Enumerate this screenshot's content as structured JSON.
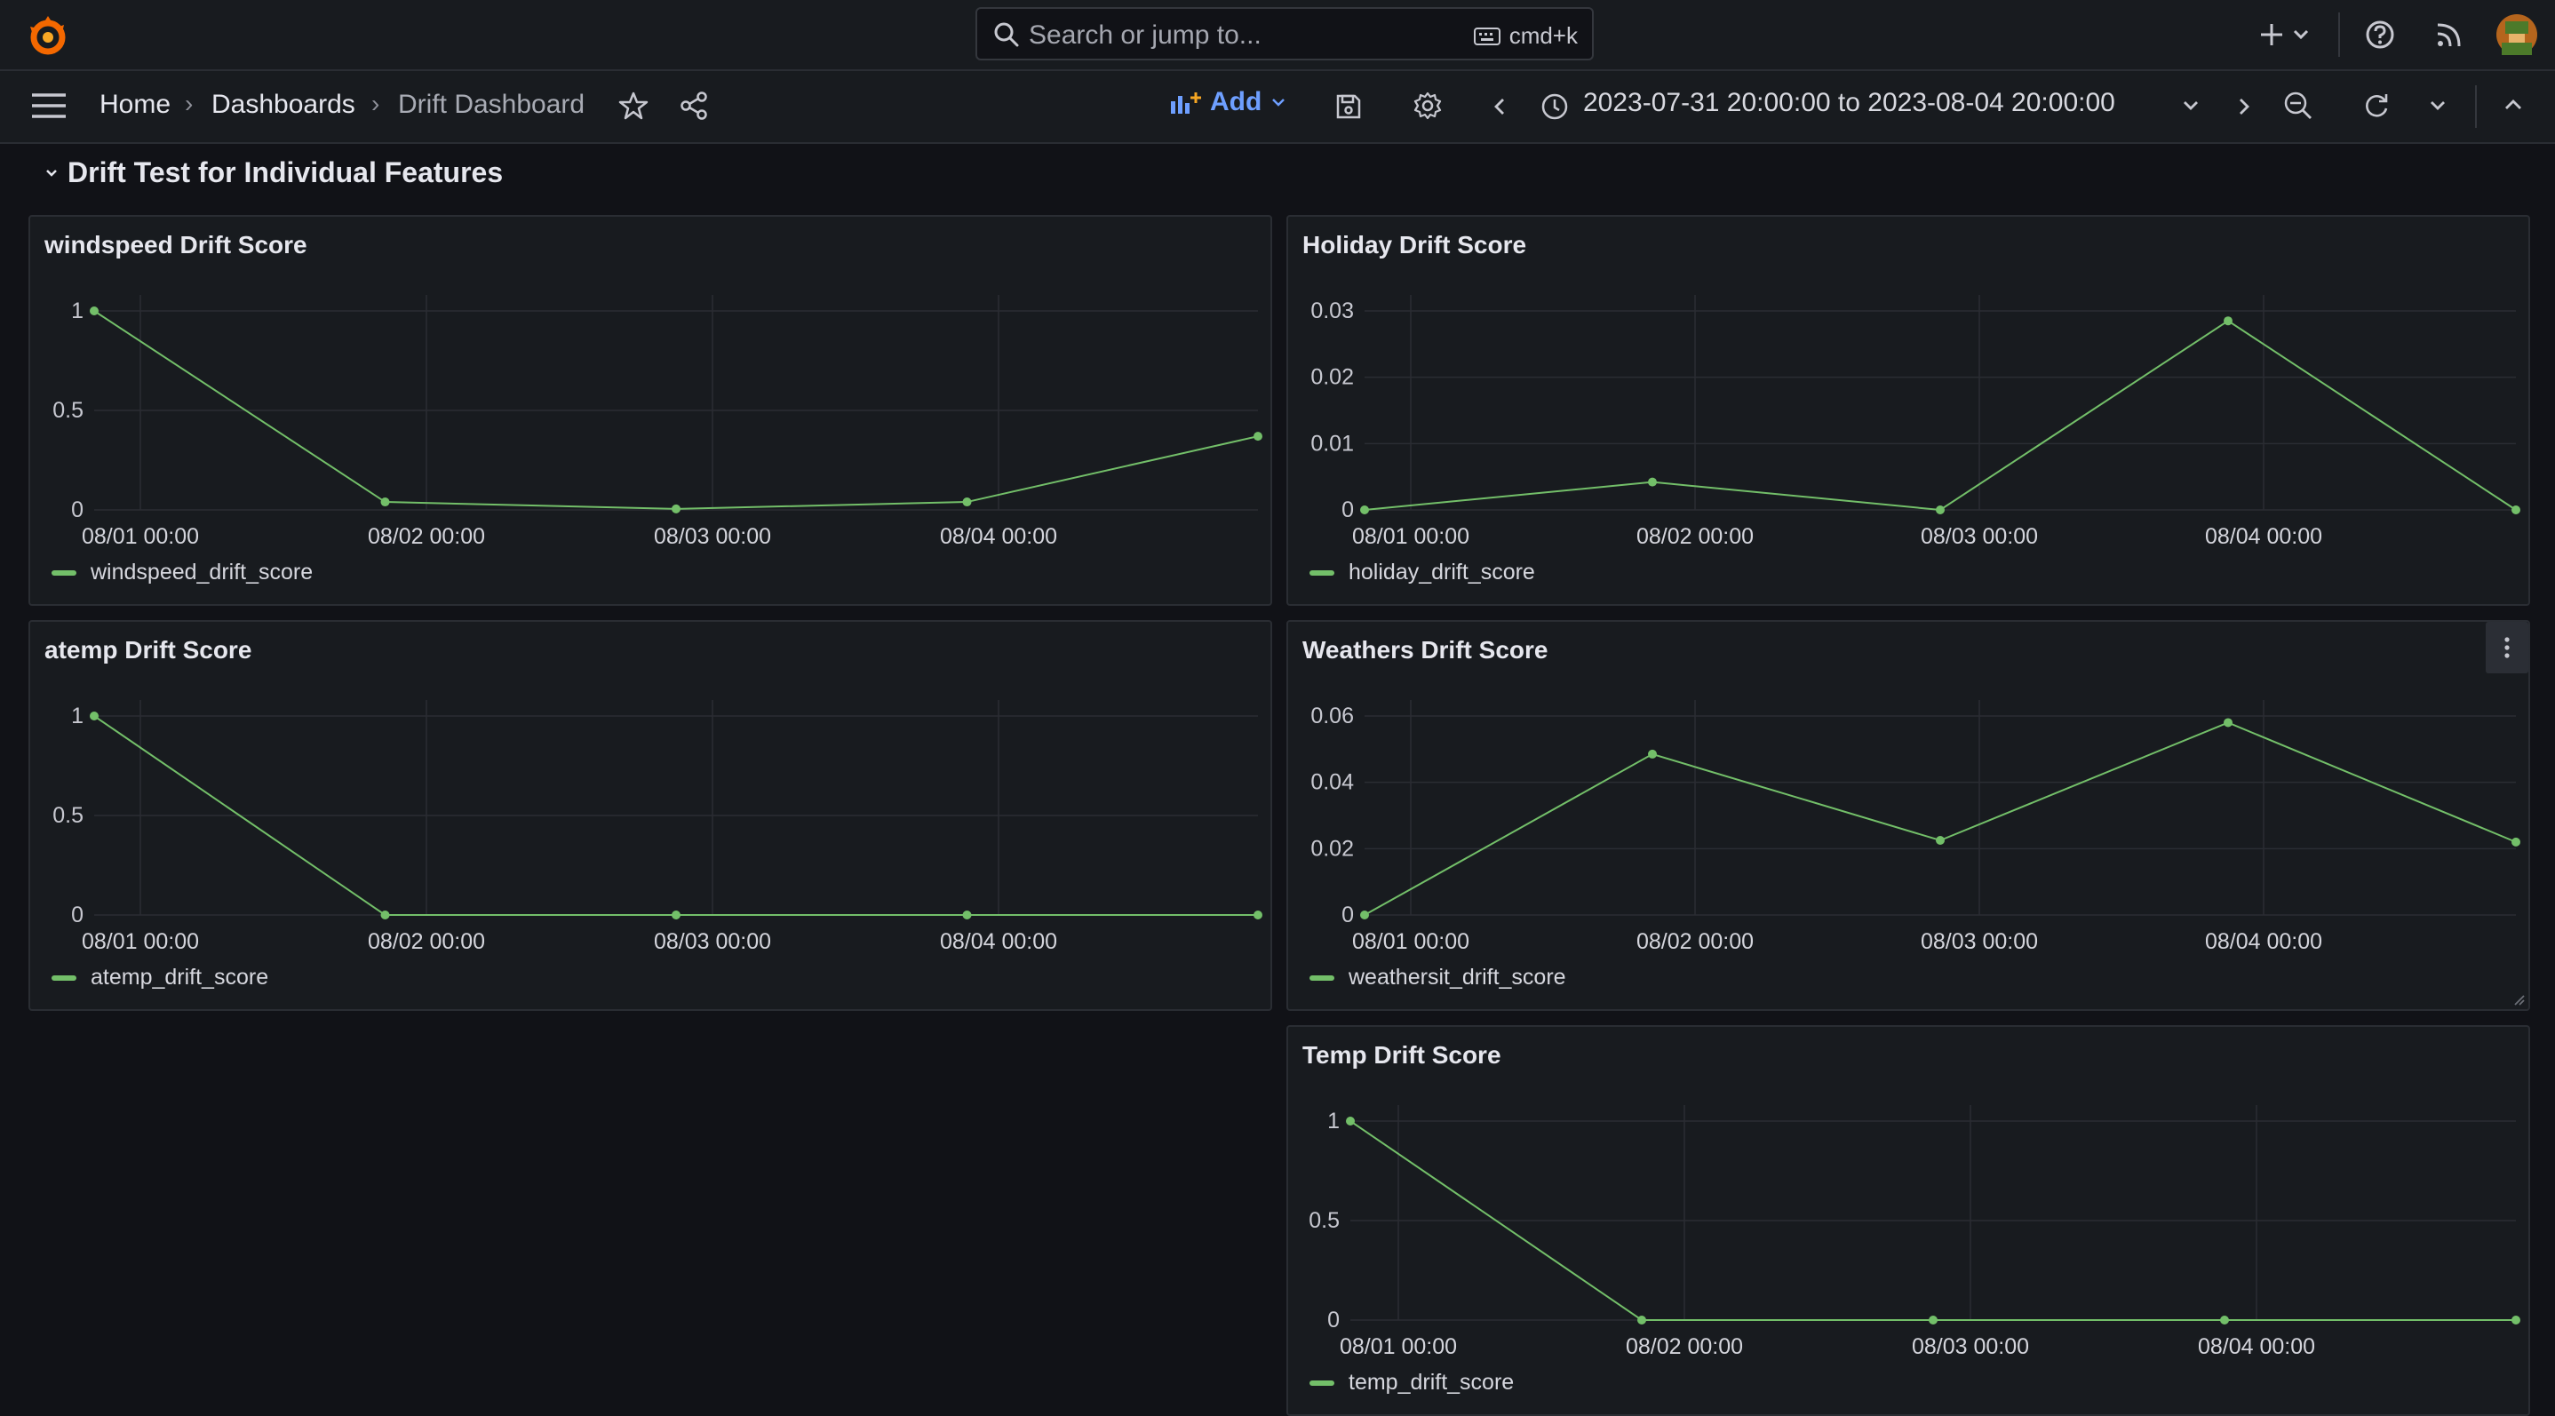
{
  "topbar": {
    "search_placeholder": "Search or jump to...",
    "shortcut": "cmd+k"
  },
  "breadcrumb": {
    "home": "Home",
    "dashboards": "Dashboards",
    "current": "Drift Dashboard"
  },
  "toolbar": {
    "add_label": "Add",
    "time_range": "2023-07-31 20:00:00 to 2023-08-04 20:00:00"
  },
  "section": {
    "title": "Drift Test for Individual Features"
  },
  "colors": {
    "series": "#73bf69",
    "accent": "#6e9fff"
  },
  "panels": [
    {
      "title": "windspeed Drift Score",
      "legend": "windspeed_drift_score",
      "chart_data": {
        "type": "line",
        "x": [
          "07/31 22:00",
          "08/01 22:00",
          "08/02 22:00",
          "08/03 22:00",
          "08/04 20:00"
        ],
        "xticks": [
          "08/01 00:00",
          "08/02 00:00",
          "08/03 00:00",
          "08/04 00:00"
        ],
        "yticks": [
          "1",
          "0.5",
          "0"
        ],
        "ylim": [
          0,
          1
        ],
        "series": [
          {
            "name": "windspeed_drift_score",
            "values": [
              1,
              0.04,
              0.005,
              0.04,
              0.37
            ]
          }
        ]
      }
    },
    {
      "title": "Holiday Drift Score",
      "legend": "holiday_drift_score",
      "chart_data": {
        "type": "line",
        "x": [
          "07/31 22:00",
          "08/01 22:00",
          "08/02 22:00",
          "08/03 22:00",
          "08/04 20:00"
        ],
        "xticks": [
          "08/01 00:00",
          "08/02 00:00",
          "08/03 00:00",
          "08/04 00:00"
        ],
        "yticks": [
          "0.03",
          "0.02",
          "0.01",
          "0"
        ],
        "ylim": [
          0,
          0.03
        ],
        "series": [
          {
            "name": "holiday_drift_score",
            "values": [
              0,
              0.0042,
              0,
              0.0285,
              0
            ]
          }
        ]
      }
    },
    {
      "title": "atemp Drift Score",
      "legend": "atemp_drift_score",
      "chart_data": {
        "type": "line",
        "x": [
          "07/31 22:00",
          "08/01 22:00",
          "08/02 22:00",
          "08/03 22:00",
          "08/04 20:00"
        ],
        "xticks": [
          "08/01 00:00",
          "08/02 00:00",
          "08/03 00:00",
          "08/04 00:00"
        ],
        "yticks": [
          "1",
          "0.5",
          "0"
        ],
        "ylim": [
          0,
          1
        ],
        "series": [
          {
            "name": "atemp_drift_score",
            "values": [
              1,
              0,
              0,
              0,
              0
            ]
          }
        ]
      }
    },
    {
      "title": "Weathers Drift Score",
      "legend": "weathersit_drift_score",
      "chart_data": {
        "type": "line",
        "x": [
          "07/31 22:00",
          "08/01 22:00",
          "08/02 22:00",
          "08/03 22:00",
          "08/04 20:00"
        ],
        "xticks": [
          "08/01 00:00",
          "08/02 00:00",
          "08/03 00:00",
          "08/04 00:00"
        ],
        "yticks": [
          "0.06",
          "0.04",
          "0.02",
          "0"
        ],
        "ylim": [
          0,
          0.06
        ],
        "series": [
          {
            "name": "weathersit_drift_score",
            "values": [
              0,
              0.0485,
              0.0225,
              0.058,
              0.022
            ]
          }
        ]
      }
    },
    {
      "title": "Temp Drift Score",
      "legend": "temp_drift_score",
      "chart_data": {
        "type": "line",
        "x": [
          "07/31 22:00",
          "08/01 22:00",
          "08/02 22:00",
          "08/03 22:00",
          "08/04 20:00"
        ],
        "xticks": [
          "08/01 00:00",
          "08/02 00:00",
          "08/03 00:00",
          "08/04 00:00"
        ],
        "yticks": [
          "1",
          "0.5",
          "0"
        ],
        "ylim": [
          0,
          1
        ],
        "series": [
          {
            "name": "temp_drift_score",
            "values": [
              1,
              0,
              0,
              0,
              0
            ]
          }
        ]
      }
    }
  ]
}
